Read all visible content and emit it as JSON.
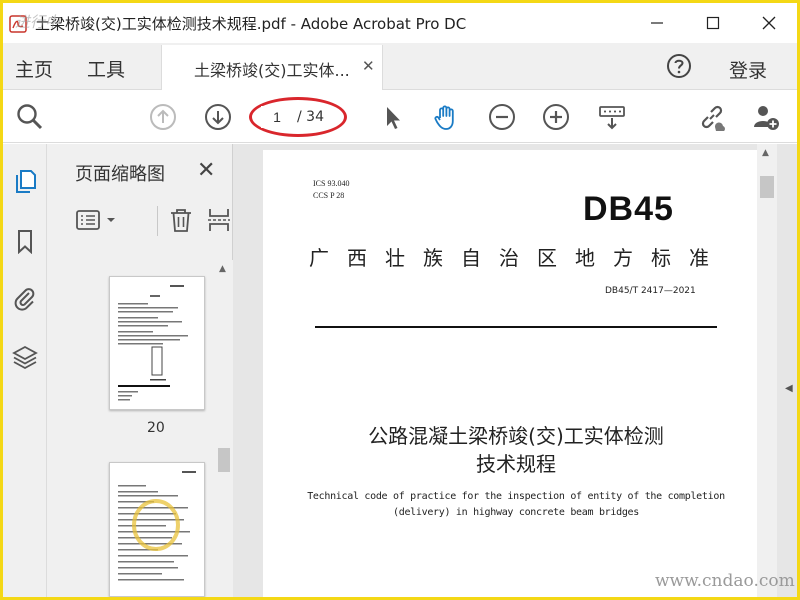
{
  "window": {
    "title": "土梁桥竣(交)工实体检测技术规程.pdf - Adobe Acrobat Pro DC",
    "app_icon": "acrobat-pdf-icon"
  },
  "menu": {
    "home": "主页",
    "tools": "工具",
    "doc_tab": "土梁桥竣(交)工实体...",
    "help_icon": "help-circle-icon",
    "login": "登录"
  },
  "toolbar": {
    "page_current": "1",
    "page_total": "/ 34"
  },
  "thumbnails": {
    "title": "页面缩略图",
    "page_label": "20"
  },
  "document": {
    "ics": "ICS 93.040",
    "ccs": "CCS P 28",
    "mark": "DB45",
    "standard_title": "广西壮族自治区地方标准",
    "standard_code": "DB45/T 2417—2021",
    "cn_title_line1": "公路混凝土梁桥竣(交)工实体检测",
    "cn_title_line2": "技术规程",
    "en_title_line1": "Technical code of practice for the inspection of entity of the completion",
    "en_title_line2": "(delivery) in highway concrete beam bridges"
  },
  "watermarks": {
    "top": "进行中",
    "bottom": "www.cndao.com"
  },
  "colors": {
    "frame": "#f4d816",
    "accent": "#1a7bc5",
    "highlight_oval": "#d9262c"
  }
}
